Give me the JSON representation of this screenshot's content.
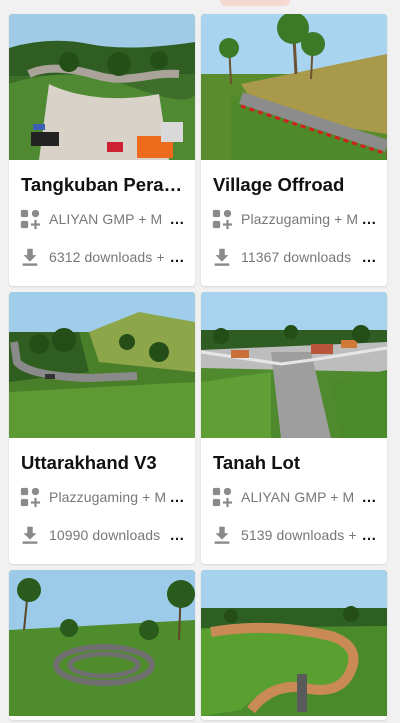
{
  "maps": [
    {
      "title": "Tangkuban Perah…",
      "author": "ALIYAN GMP + M",
      "downloads": "6312 downloads +",
      "more": "…",
      "thumb_icon": "race-track-thumbnail"
    },
    {
      "title": "Village Offroad",
      "author": "Plazzugaming + M",
      "downloads": "11367 downloads",
      "more": "…",
      "thumb_icon": "palm-hill-road-thumbnail"
    },
    {
      "title": "Uttarakhand V3",
      "author": "Plazzugaming + M",
      "downloads": "10990 downloads",
      "more": "…",
      "thumb_icon": "mountain-road-thumbnail"
    },
    {
      "title": "Tanah Lot",
      "author": "ALIYAN GMP + M",
      "downloads": "5139 downloads +",
      "more": "…",
      "thumb_icon": "town-crossroad-thumbnail"
    },
    {
      "thumb_icon": "forest-loop-thumbnail"
    },
    {
      "thumb_icon": "dirt-track-thumbnail"
    }
  ],
  "icons": {
    "author": "apps-add-icon",
    "download": "download-icon"
  },
  "colors": {
    "card_bg": "#ffffff",
    "page_bg": "#f1f1f1",
    "meta_text": "#777777",
    "icon_gray": "#8a8a8a"
  }
}
